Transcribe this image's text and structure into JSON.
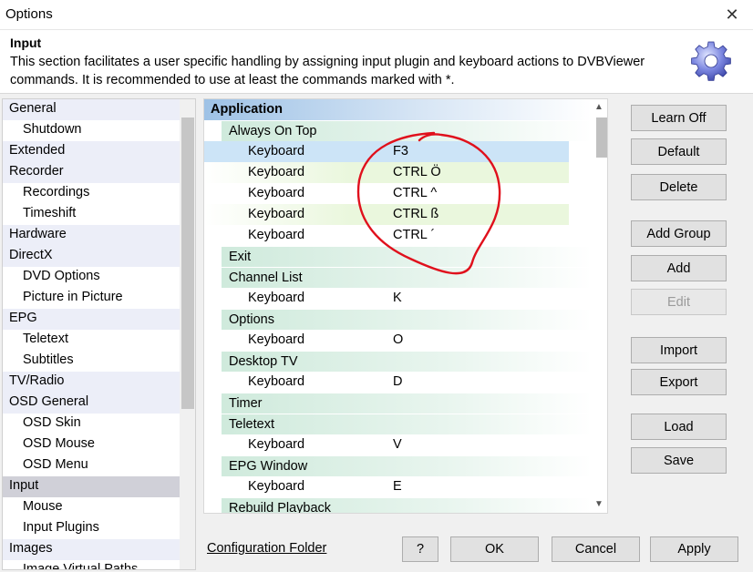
{
  "window": {
    "title": "Options"
  },
  "header": {
    "title": "Input",
    "description": "This section facilitates a user specific handling by assigning input plugin and keyboard actions to DVBViewer commands. It is recommended to use at least the commands marked with *."
  },
  "nav": {
    "items": [
      {
        "label": "General",
        "level": 0
      },
      {
        "label": "Shutdown",
        "level": 1
      },
      {
        "label": "Extended",
        "level": 0
      },
      {
        "label": "Recorder",
        "level": 0
      },
      {
        "label": "Recordings",
        "level": 1
      },
      {
        "label": "Timeshift",
        "level": 1
      },
      {
        "label": "Hardware",
        "level": 0
      },
      {
        "label": "DirectX",
        "level": 0
      },
      {
        "label": "DVD Options",
        "level": 1
      },
      {
        "label": "Picture in Picture",
        "level": 1
      },
      {
        "label": "EPG",
        "level": 0
      },
      {
        "label": "Teletext",
        "level": 1
      },
      {
        "label": "Subtitles",
        "level": 1
      },
      {
        "label": "TV/Radio",
        "level": 0
      },
      {
        "label": "OSD General",
        "level": 0
      },
      {
        "label": "OSD Skin",
        "level": 1
      },
      {
        "label": "OSD Mouse",
        "level": 1
      },
      {
        "label": "OSD Menu",
        "level": 1
      },
      {
        "label": "Input",
        "level": 0,
        "selected": true
      },
      {
        "label": "Mouse",
        "level": 1
      },
      {
        "label": "Input Plugins",
        "level": 1
      },
      {
        "label": "Images",
        "level": 0
      },
      {
        "label": "Image Virtual Paths",
        "level": 1
      }
    ]
  },
  "tree": {
    "rows": [
      {
        "type": "root",
        "label": "Application",
        "value": ""
      },
      {
        "type": "group",
        "label": "Always On Top",
        "value": ""
      },
      {
        "type": "child",
        "label": "Keyboard",
        "value": "F3",
        "style": "sel"
      },
      {
        "type": "child",
        "label": "Keyboard",
        "value": "CTRL Ö",
        "style": "alt"
      },
      {
        "type": "child",
        "label": "Keyboard",
        "value": "CTRL ^",
        "style": ""
      },
      {
        "type": "child",
        "label": "Keyboard",
        "value": "CTRL ß",
        "style": "alt"
      },
      {
        "type": "child",
        "label": "Keyboard",
        "value": "CTRL ´",
        "style": ""
      },
      {
        "type": "group",
        "label": "Exit",
        "value": ""
      },
      {
        "type": "group",
        "label": "Channel List",
        "value": ""
      },
      {
        "type": "child",
        "label": "Keyboard",
        "value": "K",
        "style": ""
      },
      {
        "type": "group",
        "label": "Options",
        "value": ""
      },
      {
        "type": "child",
        "label": "Keyboard",
        "value": "O",
        "style": ""
      },
      {
        "type": "group",
        "label": "Desktop TV",
        "value": ""
      },
      {
        "type": "child",
        "label": "Keyboard",
        "value": "D",
        "style": ""
      },
      {
        "type": "group",
        "label": "Timer",
        "value": ""
      },
      {
        "type": "group",
        "label": "Teletext",
        "value": ""
      },
      {
        "type": "child",
        "label": "Keyboard",
        "value": "V",
        "style": ""
      },
      {
        "type": "group",
        "label": "EPG Window",
        "value": ""
      },
      {
        "type": "child",
        "label": "Keyboard",
        "value": "E",
        "style": ""
      },
      {
        "type": "group",
        "label": "Rebuild Playback",
        "value": ""
      }
    ]
  },
  "buttons": {
    "learn_off": "Learn Off",
    "default": "Default",
    "delete": "Delete",
    "add_group": "Add Group",
    "add": "Add",
    "edit": "Edit",
    "import": "Import",
    "export": "Export",
    "load": "Load",
    "save": "Save",
    "help": "?",
    "ok": "OK",
    "cancel": "Cancel",
    "apply": "Apply"
  },
  "footer": {
    "config_folder_link": "Configuration Folder"
  },
  "icons": {
    "close": "close-icon",
    "gear": "gear-icon",
    "scroll_up": "chevron-up-icon",
    "scroll_down": "chevron-down-icon"
  },
  "colors": {
    "annotation": "#e0101c",
    "root_header": "#9ec2e6",
    "group_header": "#cfeadc",
    "selected_row": "#cce4f7"
  }
}
